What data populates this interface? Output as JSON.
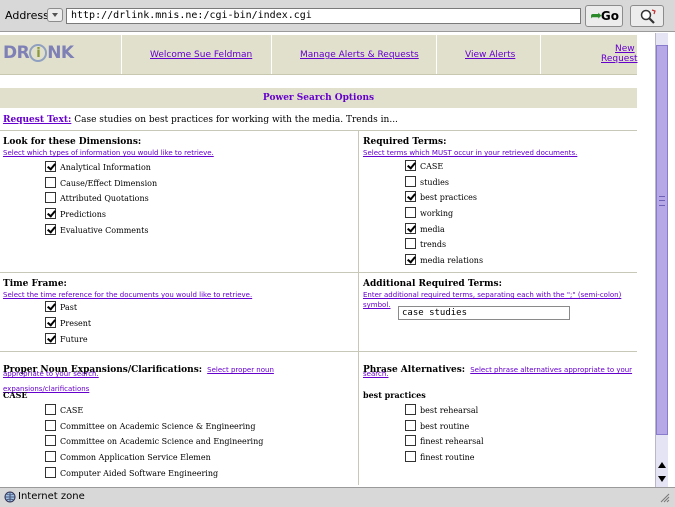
{
  "browser": {
    "address_label": "Address:",
    "url": "http://drlink.mnis.ne:/cgi-bin/index.cgi",
    "go_label": "Go",
    "status_text": "Internet zone"
  },
  "nav": {
    "logo_left": "DR",
    "logo_i": "i",
    "logo_right": "NK",
    "welcome": "Welcome Sue Feldman",
    "manage": "Manage Alerts & Requests",
    "view": "View Alerts",
    "new_line1": "New",
    "new_line2": "Request"
  },
  "page": {
    "title": "Power Search Options",
    "request_label": "Request Text:",
    "request_value": "Case studies on best practices for working with the media. Trends in..."
  },
  "dimensions": {
    "heading": "Look for these Dimensions:",
    "subtitle": "Select which types of information you would like to retrieve.",
    "items": [
      {
        "label": "Analytical Information",
        "checked": true
      },
      {
        "label": "Cause/Effect Dimension",
        "checked": false
      },
      {
        "label": "Attributed Quotations",
        "checked": false
      },
      {
        "label": "Predictions",
        "checked": true
      },
      {
        "label": "Evaluative Comments",
        "checked": true
      }
    ]
  },
  "required_terms": {
    "heading": "Required Terms:",
    "subtitle": "Select terms which MUST occur in your retrieved documents.",
    "items": [
      {
        "label": "CASE",
        "checked": true
      },
      {
        "label": "studies",
        "checked": false
      },
      {
        "label": "best practices",
        "checked": true
      },
      {
        "label": "working",
        "checked": false
      },
      {
        "label": "media",
        "checked": true
      },
      {
        "label": "trends",
        "checked": false
      },
      {
        "label": "media relations",
        "checked": true
      }
    ]
  },
  "time_frame": {
    "heading": "Time Frame:",
    "subtitle": "Select the time reference for the documents you would like to retrieve.",
    "items": [
      {
        "label": "Past",
        "checked": true
      },
      {
        "label": "Present",
        "checked": true
      },
      {
        "label": "Future",
        "checked": true
      }
    ]
  },
  "additional_terms": {
    "heading": "Additional Required Terms:",
    "subtitle_line1": "Enter additional required terms, separating each with the \";\" (semi-colon)",
    "subtitle_line2": "symbol.",
    "value": "case studies"
  },
  "proper_noun": {
    "heading": "Proper Noun Expansions/Clarifications:",
    "subtitle_inline": "Select proper noun expansions/clarifications",
    "subtitle_line2": "appropriate to your search.",
    "group_label": "CASE",
    "items": [
      {
        "label": "CASE",
        "checked": false
      },
      {
        "label": "Committee on Academic Science & Engineering",
        "checked": false
      },
      {
        "label": "Committee on Academic Science and Engineering",
        "checked": false
      },
      {
        "label": "Common Application Service Elemen",
        "checked": false
      },
      {
        "label": "Computer Aided Software Engineering",
        "checked": false
      }
    ]
  },
  "phrase_alt": {
    "heading": "Phrase Alternatives:",
    "subtitle_inline": "Select phrase alternatives appropriate to your",
    "subtitle_line2": "search.",
    "group_label": "best practices",
    "items": [
      {
        "label": "best rehearsal",
        "checked": false
      },
      {
        "label": "best routine",
        "checked": false
      },
      {
        "label": "finest rehearsal",
        "checked": false
      },
      {
        "label": "finest routine",
        "checked": false
      }
    ]
  }
}
